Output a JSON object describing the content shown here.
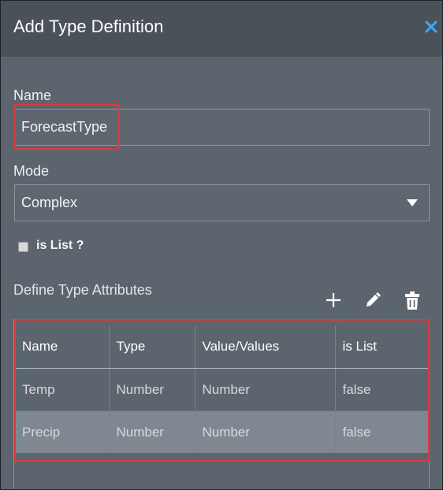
{
  "dialog": {
    "title": "Add Type Definition",
    "close_icon": "close-icon"
  },
  "form": {
    "name_label": "Name",
    "name_value": "ForecastType",
    "mode_label": "Mode",
    "mode_value": "Complex",
    "is_list_label": "is List ?",
    "is_list_checked": false
  },
  "attributes": {
    "section_label": "Define Type Attributes",
    "tools": [
      "add-icon",
      "edit-icon",
      "delete-icon"
    ],
    "columns": [
      "Name",
      "Type",
      "Value/Values",
      "is List"
    ],
    "rows": [
      {
        "name": "Temp",
        "type": "Number",
        "values": "Number",
        "is_list": "false"
      },
      {
        "name": "Precip",
        "type": "Number",
        "values": "Number",
        "is_list": "false"
      }
    ]
  },
  "colors": {
    "highlight": "#e0383c",
    "close": "#3fa9f5",
    "header": "#4a5159",
    "body": "#5c646d",
    "selected_row": "#7f8890"
  }
}
